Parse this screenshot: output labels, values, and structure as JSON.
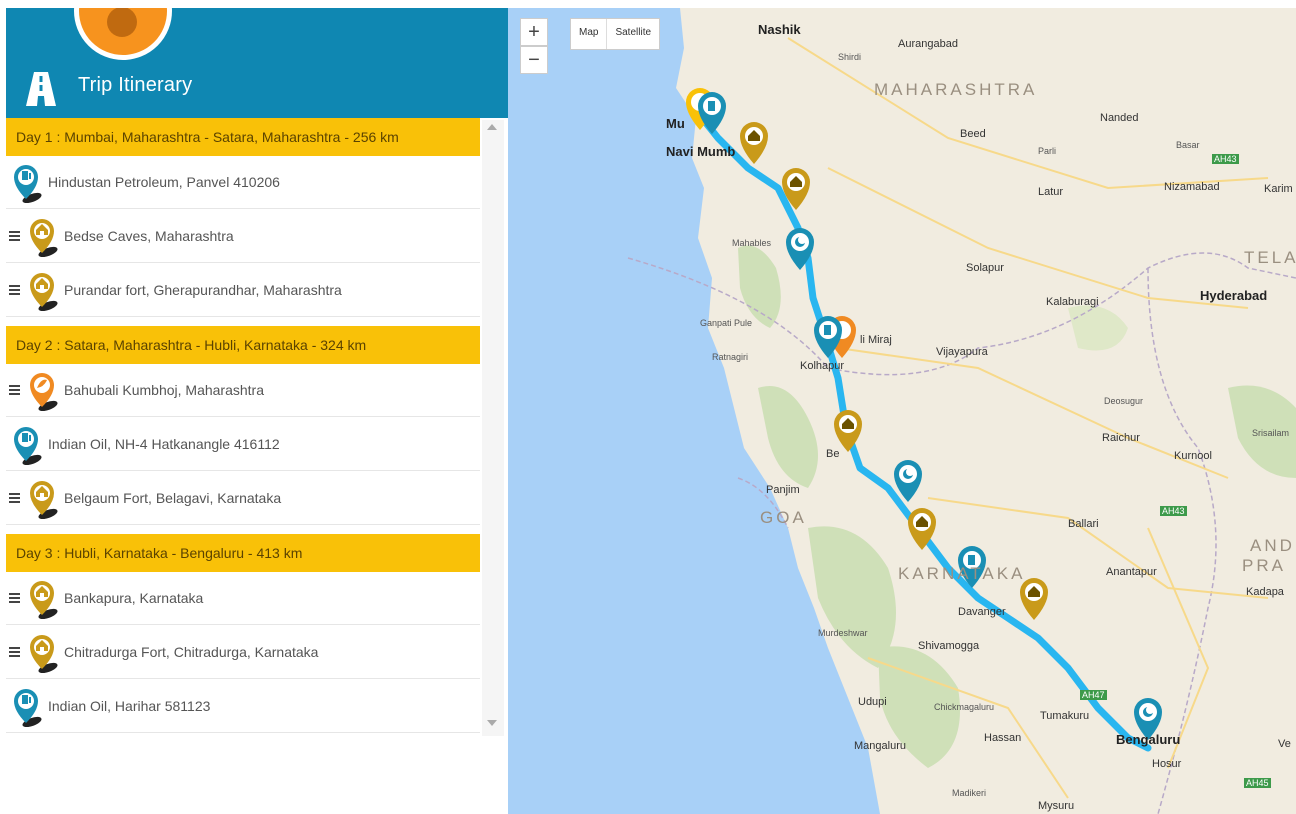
{
  "app": {
    "title": "Trip Itinerary"
  },
  "itinerary": [
    {
      "type": "day",
      "label": "Day 1 : Mumbai, Maharashtra - Satara, Maharashtra - 256 km"
    },
    {
      "type": "stop",
      "kind": "fuel",
      "label": "Hindustan Petroleum, Panvel 410206"
    },
    {
      "type": "stop",
      "kind": "monument",
      "label": "Bedse Caves, Maharashtra"
    },
    {
      "type": "stop",
      "kind": "monument",
      "label": "Purandar fort, Gherapurandhar, Maharashtra"
    },
    {
      "type": "day",
      "label": "Day 2 : Satara, Maharashtra - Hubli, Karnataka - 324 km"
    },
    {
      "type": "stop",
      "kind": "food",
      "label": "Bahubali Kumbhoj, Maharashtra"
    },
    {
      "type": "stop",
      "kind": "fuel",
      "label": "Indian Oil, NH-4 Hatkanangle 416112"
    },
    {
      "type": "stop",
      "kind": "monument",
      "label": "Belgaum Fort, Belagavi, Karnataka"
    },
    {
      "type": "day",
      "label": "Day 3 : Hubli, Karnataka - Bengaluru - 413 km"
    },
    {
      "type": "stop",
      "kind": "monument",
      "label": "Bankapura, Karnataka"
    },
    {
      "type": "stop",
      "kind": "monument",
      "label": "Chitradurga Fort, Chitradurga, Karnataka"
    },
    {
      "type": "stop",
      "kind": "fuel",
      "label": "Indian Oil, Harihar 581123"
    }
  ],
  "map": {
    "zoom_in": "+",
    "zoom_out": "−",
    "type_map": "Map",
    "type_satellite": "Satellite",
    "labels": {
      "nashik": "Nashik",
      "aurangabad": "Aurangabad",
      "shirdi": "Shirdi",
      "maharashtra": "MAHARASHTRA",
      "nanded": "Nanded",
      "beed": "Beed",
      "parli": "Parli",
      "basar": "Basar",
      "nizamabad": "Nizamabad",
      "karim": "Karim",
      "latur": "Latur",
      "navi_mumbai": "Navi Mumb",
      "mahabaleshwar": "Mahables",
      "solapur": "Solapur",
      "tela": "TELA",
      "hyderabad": "Hyderabad",
      "kalaburagi": "Kalaburagi",
      "ganpatipule": "Ganpati Pule",
      "ratnagiri": "Ratnagiri",
      "miraj": "li Miraj",
      "vijayapura": "Vijayapura",
      "kolhapur": "Kolhapur",
      "deosugur": "Deosugur",
      "raichur": "Raichur",
      "srisailam": "Srisailam",
      "kurnool": "Kurnool",
      "panjim": "Panjim",
      "goa": "GOA",
      "ballari": "Ballari",
      "karnataka": "KARNATAKA",
      "anantapur": "Anantapur",
      "andhra": "AND",
      "pradesh": "PRA",
      "kadapa": "Kadapa",
      "murdeshwar": "Murdeshwar",
      "davangere": "Davanger",
      "shivamogga": "Shivamogga",
      "udupi": "Udupi",
      "chickmagaluru": "Chickmagaluru",
      "tumakuru": "Tumakuru",
      "mangaluru": "Mangaluru",
      "hassan": "Hassan",
      "bengaluru": "Bengaluru",
      "hosur": "Hosur",
      "madikeri": "Madikeri",
      "mysuru": "Mysuru",
      "vel": "Ve",
      "ah43": "AH43",
      "ah45": "AH45",
      "ah47": "AH47",
      "mu": "Mu",
      "be": "Be"
    }
  },
  "colors": {
    "header": "#0f87b2",
    "day_bar": "#f9c108",
    "route": "#29b6f0",
    "sea": "#a8d0f7",
    "land": "#f1ece0",
    "pin_fuel": "#1a8fb4",
    "pin_monument": "#c99a1a",
    "pin_food": "#f08a22"
  }
}
